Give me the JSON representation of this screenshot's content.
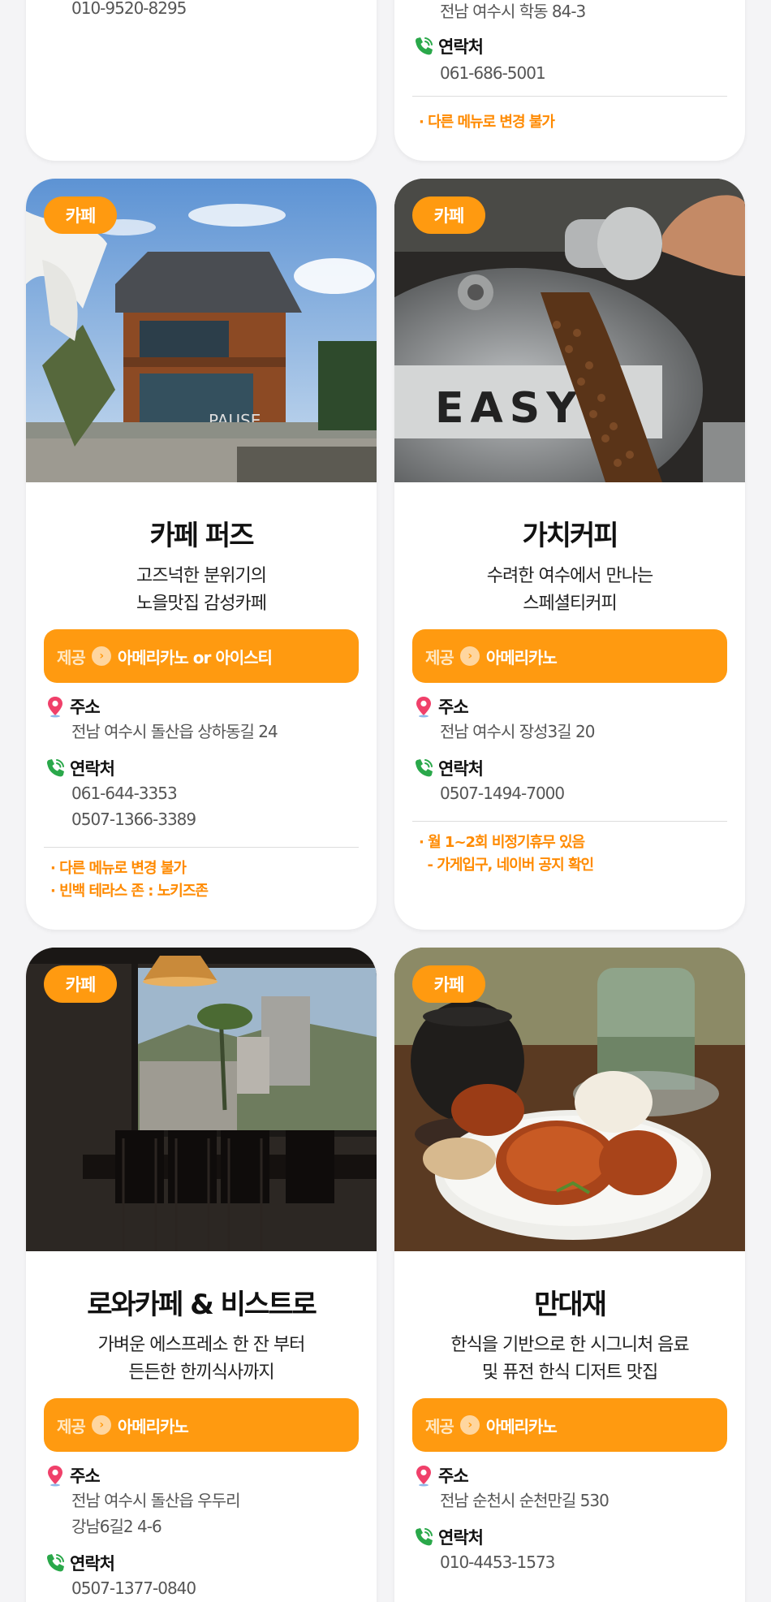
{
  "top_left": {
    "phone": "010-9520-8295"
  },
  "top_right": {
    "address": "전남 여수시 학동 84-3",
    "contact_label": "연락처",
    "phone": "061-686-5001",
    "note": "· 다른 메뉴로 변경 불가"
  },
  "cards": [
    {
      "badge": "카페",
      "name": "카페 퍼즈",
      "desc1": "고즈넉한 분위기의",
      "desc2": "노을맛집 감성카페",
      "provide_label": "제공",
      "provide_item": "아메리카노 or 아이스티",
      "address_label": "주소",
      "address1": "전남 여수시 돌산읍 상하동길 24",
      "contact_label": "연락처",
      "phone1": "061-644-3353",
      "phone2": "0507-1366-3389",
      "note1": "· 다른 메뉴로 변경 불가",
      "note2": "· 빈백 테라스 존 : 노키즈존"
    },
    {
      "badge": "카페",
      "name": "가치커피",
      "desc1": "수려한 여수에서 만나는",
      "desc2": "스페셜티커피",
      "provide_label": "제공",
      "provide_item": "아메리카노",
      "address_label": "주소",
      "address1": "전남 여수시 장성3길 20",
      "contact_label": "연락처",
      "phone1": "0507-1494-7000",
      "note1": "· 월 1~2회 비정기휴무 있음",
      "note2": "  - 가게입구, 네이버 공지 확인"
    },
    {
      "badge": "카페",
      "name": "로와카페 & 비스트로",
      "desc1": "가벼운 에스프레소 한 잔 부터",
      "desc2": "든든한 한끼식사까지",
      "provide_label": "제공",
      "provide_item": "아메리카노",
      "address_label": "주소",
      "address1": "전남 여수시 돌산읍 우두리",
      "address2": "강남6길2 4-6",
      "contact_label": "연락처",
      "phone1": "0507-1377-0840"
    },
    {
      "badge": "카페",
      "name": "만대재",
      "desc1": "한식을 기반으로 한 시그니처 음료",
      "desc2": "및 퓨전 한식 디저트 맛집",
      "provide_label": "제공",
      "provide_item": "아메리카노",
      "address_label": "주소",
      "address1": "전남 순천시 순천만길 530",
      "contact_label": "연락처",
      "phone1": "010-4453-1573"
    }
  ],
  "colors": {
    "accent": "#ff9a10",
    "note": "#ff8a00",
    "pin": "#f0406a",
    "phone": "#2aa84a"
  },
  "icons": {
    "pin": "location-pin-icon",
    "phone": "phone-icon",
    "arrow": "chevron-right-icon"
  }
}
